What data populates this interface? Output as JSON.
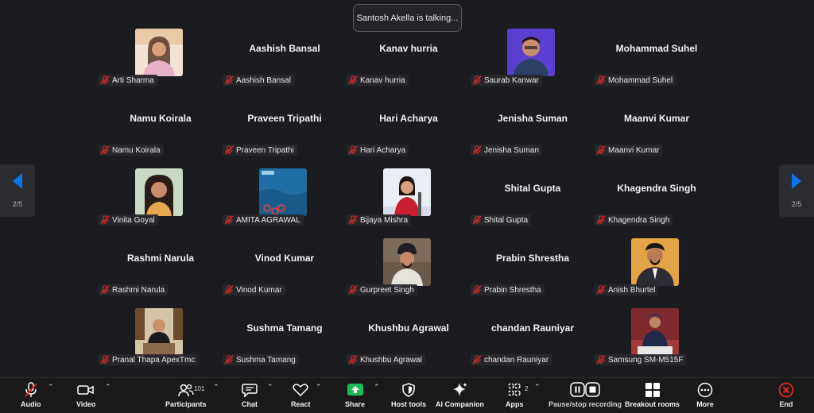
{
  "toast": {
    "text": "Santosh Akella is talking..."
  },
  "nav": {
    "left_page": "2/5",
    "right_page": "2/5"
  },
  "participants": [
    {
      "name": "Arti Sharma",
      "big": "",
      "photo": "p-arti"
    },
    {
      "name": "Aashish Bansal",
      "big": "Aashish Bansal",
      "photo": ""
    },
    {
      "name": "Kanav hurria",
      "big": "Kanav hurria",
      "photo": ""
    },
    {
      "name": "Saurab Kanwar",
      "big": "",
      "photo": "p-saurab"
    },
    {
      "name": "Mohammad Suhel",
      "big": "Mohammad Suhel",
      "photo": ""
    },
    {
      "name": "Namu Koirala",
      "big": "Namu Koirala",
      "photo": ""
    },
    {
      "name": "Praveen Tripathi",
      "big": "Praveen Tripathi",
      "photo": ""
    },
    {
      "name": "Hari Acharya",
      "big": "Hari Acharya",
      "photo": ""
    },
    {
      "name": "Jenisha Suman",
      "big": "Jenisha Suman",
      "photo": ""
    },
    {
      "name": "Maanvi Kumar",
      "big": "Maanvi Kumar",
      "photo": ""
    },
    {
      "name": "Vinita Goyal",
      "big": "",
      "photo": "p-vinita"
    },
    {
      "name": "AMITA AGRAWAL",
      "big": "",
      "photo": "p-amita"
    },
    {
      "name": "Bijaya Mishra",
      "big": "",
      "photo": "p-bijaya"
    },
    {
      "name": "Shital Gupta",
      "big": "Shital Gupta",
      "photo": ""
    },
    {
      "name": "Khagendra Singh",
      "big": "Khagendra Singh",
      "photo": ""
    },
    {
      "name": "Rashmi Narula",
      "big": "Rashmi Narula",
      "photo": ""
    },
    {
      "name": "Vinod Kumar",
      "big": "Vinod Kumar",
      "photo": ""
    },
    {
      "name": "Gurpreet Singh",
      "big": "",
      "photo": "p-gurpreet"
    },
    {
      "name": "Prabin Shrestha",
      "big": "Prabin Shrestha",
      "photo": ""
    },
    {
      "name": "Anish Bhurtel",
      "big": "",
      "photo": "p-anish"
    },
    {
      "name": "Pranal Thapa ApexTmc",
      "big": "",
      "photo": "p-pranal"
    },
    {
      "name": "Sushma Tamang",
      "big": "Sushma Tamang",
      "photo": ""
    },
    {
      "name": "Khushbu Agrawal",
      "big": "Khushbu Agrawal",
      "photo": ""
    },
    {
      "name": "chandan Rauniyar",
      "big": "chandan Rauniyar",
      "photo": ""
    },
    {
      "name": "Samsung SM-M515F",
      "big": "",
      "photo": "p-samsung"
    }
  ],
  "toolbar": {
    "audio": "Audio",
    "video": "Video",
    "participants": "Participants",
    "participants_count": "101",
    "chat": "Chat",
    "react": "React",
    "share": "Share",
    "host_tools": "Host tools",
    "ai_companion": "AI Companion",
    "apps": "Apps",
    "apps_count": "2",
    "recording": "Pause/stop recording",
    "breakout": "Breakout rooms",
    "more": "More",
    "end": "End"
  },
  "colors": {
    "accent": "#0e72ed",
    "share_green": "#1db954",
    "end_red": "#e02828",
    "mic_muted": "#e02828"
  }
}
